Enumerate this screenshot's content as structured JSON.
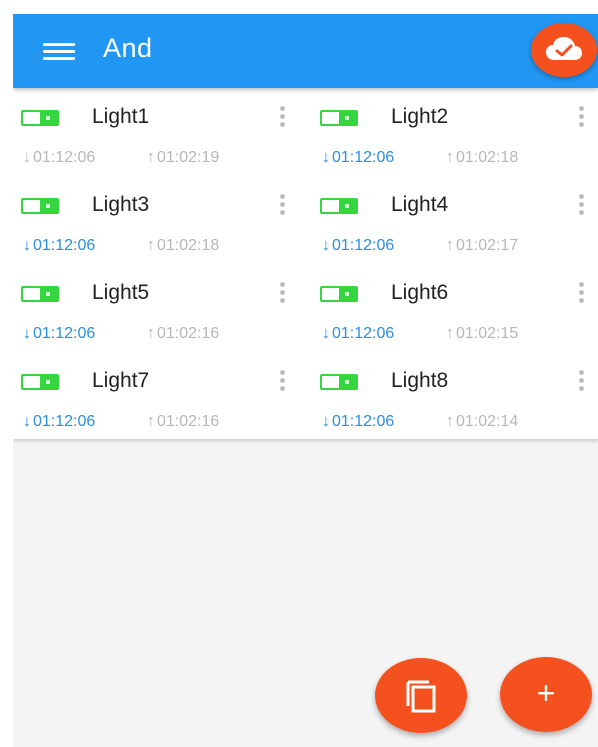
{
  "appbar": {
    "title": "And",
    "menu_icon": "hamburger-menu-icon",
    "cloud_icon": "cloud-check-icon"
  },
  "colors": {
    "appbar": "#2196f3",
    "accent": "#f4511e",
    "toggle_on": "#35d640",
    "time_active": "#2a8fe0",
    "time_inactive": "#b7b7b7"
  },
  "lights": [
    {
      "name": "Light1",
      "down_time": "01:12:06",
      "up_time": "01:02:19",
      "down_active": false,
      "on": true
    },
    {
      "name": "Light2",
      "down_time": "01:12:06",
      "up_time": "01:02:18",
      "down_active": true,
      "on": true
    },
    {
      "name": "Light3",
      "down_time": "01:12:06",
      "up_time": "01:02:18",
      "down_active": true,
      "on": true
    },
    {
      "name": "Light4",
      "down_time": "01:12:06",
      "up_time": "01:02:17",
      "down_active": true,
      "on": true
    },
    {
      "name": "Light5",
      "down_time": "01:12:06",
      "up_time": "01:02:16",
      "down_active": true,
      "on": true
    },
    {
      "name": "Light6",
      "down_time": "01:12:06",
      "up_time": "01:02:15",
      "down_active": true,
      "on": true
    },
    {
      "name": "Light7",
      "down_time": "01:12:06",
      "up_time": "01:02:16",
      "down_active": true,
      "on": true
    },
    {
      "name": "Light8",
      "down_time": "01:12:06",
      "up_time": "01:02:14",
      "down_active": true,
      "on": true
    }
  ],
  "fabs": {
    "copy_icon": "copy-icon",
    "add_label": "+"
  }
}
